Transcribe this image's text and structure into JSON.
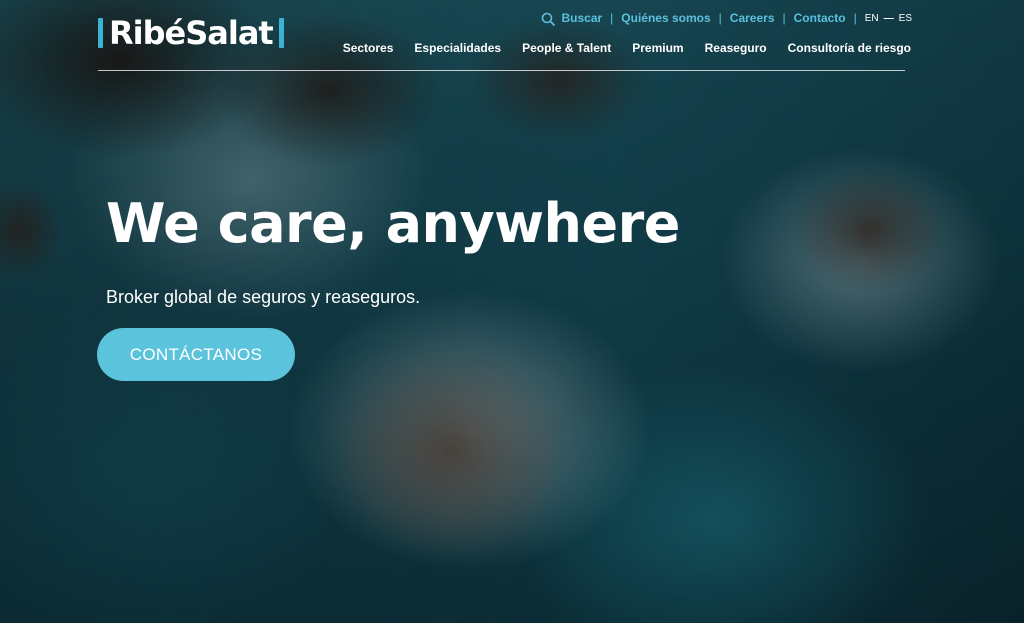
{
  "brand": {
    "name": "RibéSalat",
    "accent_color": "#3bb3d6"
  },
  "topbar": {
    "search_label": "Buscar",
    "links": [
      "Quiénes somos",
      "Careers",
      "Contacto"
    ],
    "lang_en": "EN",
    "lang_dash": "—",
    "lang_es": "ES",
    "link_color": "#5bc0de"
  },
  "nav": {
    "items": [
      "Sectores",
      "Especialidades",
      "People & Talent",
      "Premium",
      "Reaseguro",
      "Consultoría de riesgo"
    ]
  },
  "hero": {
    "title": "We care, anywhere",
    "subtitle": "Broker global de seguros y reaseguros.",
    "cta_label": "CONTÁCTANOS",
    "cta_color": "#5bc3dc"
  },
  "icons": {
    "search": "search-icon"
  }
}
